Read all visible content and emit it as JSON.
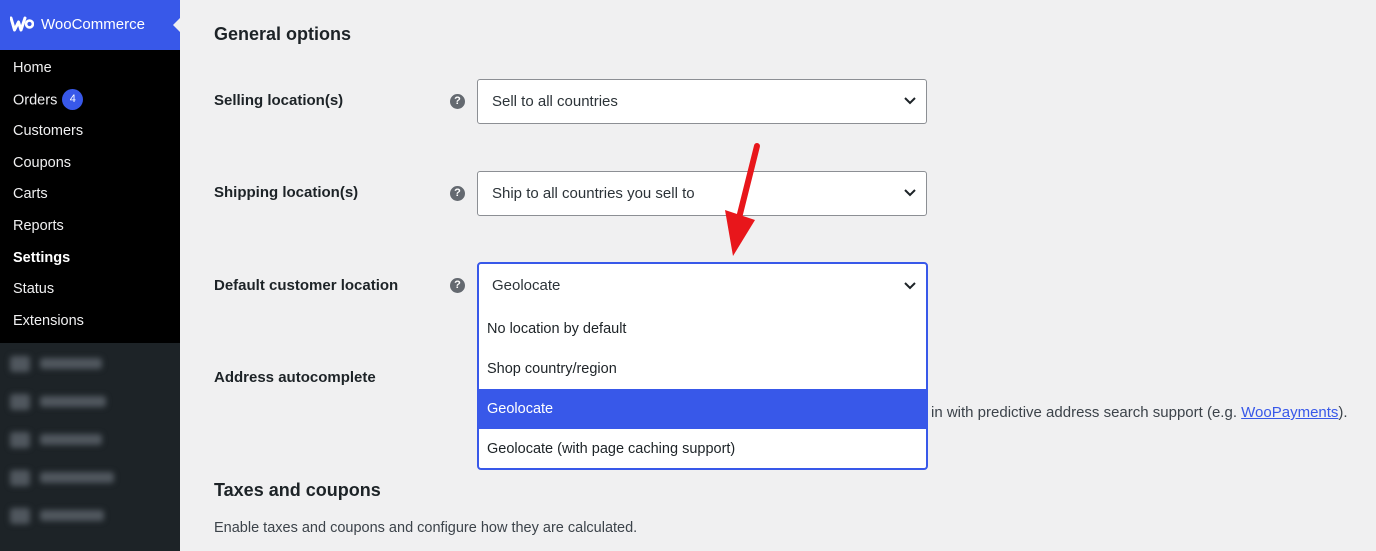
{
  "sidebar": {
    "brand": "WooCommerce",
    "items": [
      {
        "label": "Home"
      },
      {
        "label": "Orders",
        "badge": "4"
      },
      {
        "label": "Customers"
      },
      {
        "label": "Coupons"
      },
      {
        "label": "Carts"
      },
      {
        "label": "Reports"
      },
      {
        "label": "Settings",
        "active": true
      },
      {
        "label": "Status"
      },
      {
        "label": "Extensions"
      }
    ]
  },
  "main": {
    "general_title": "General options",
    "selling": {
      "label": "Selling location(s)",
      "value": "Sell to all countries"
    },
    "shipping": {
      "label": "Shipping location(s)",
      "value": "Ship to all countries you sell to"
    },
    "default_location": {
      "label": "Default customer location",
      "value": "Geolocate",
      "options": [
        "No location by default",
        "Shop country/region",
        "Geolocate",
        "Geolocate (with page caching support)"
      ],
      "highlighted_option": "Geolocate"
    },
    "address_autocomplete": {
      "label": "Address autocomplete",
      "desc_text": "in with predictive address search support (e.g. ",
      "desc_link": "WooPayments",
      "desc_end": ")."
    },
    "taxes_title": "Taxes and coupons",
    "taxes_desc": "Enable taxes and coupons and configure how they are calculated."
  },
  "colors": {
    "accent": "#3858e9",
    "annotation_arrow": "#e8161b",
    "sidebar_bg": "#1d2327",
    "submenu_bg": "#000000"
  },
  "icons": {
    "brand": "woocommerce-logo-icon",
    "help": "help-icon",
    "select": "chevron-down-icon"
  }
}
